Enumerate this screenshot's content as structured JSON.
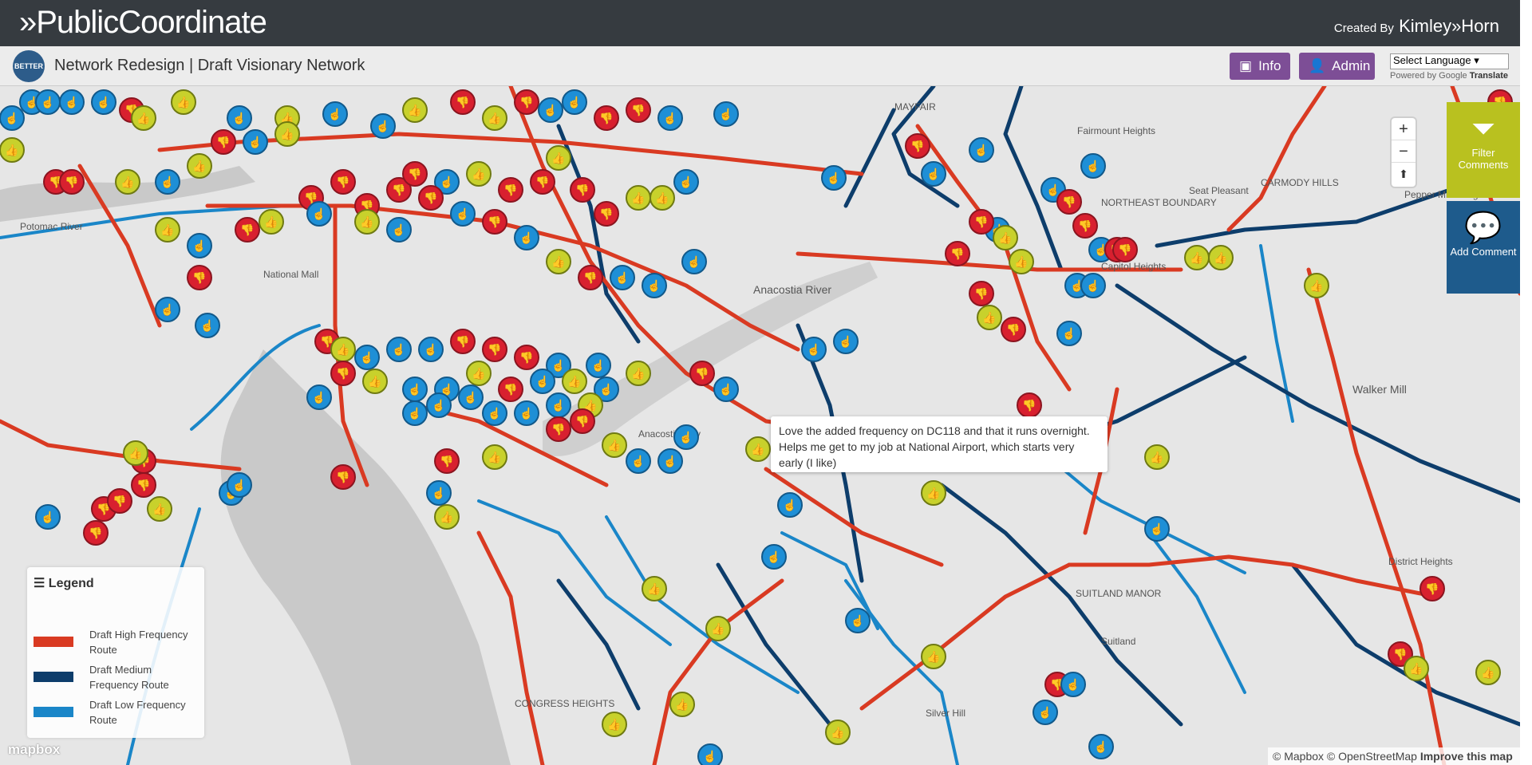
{
  "header": {
    "brand": "»PublicCoordinate",
    "credit_prefix": "Created By",
    "credit_name": "Kimley»Horn"
  },
  "subheader": {
    "logo_text": "BETTER BUS",
    "title": "Network Redesign | Draft Visionary Network",
    "info_label": "Info",
    "admin_label": "Admin",
    "language_select": "Select Language",
    "powered_by": "Powered by",
    "google": "Google",
    "translate": "Translate"
  },
  "map": {
    "zoom_in": "+",
    "zoom_out": "−",
    "reset_north": "⬆",
    "filter_label": "Filter Comments",
    "add_label": "Add Comment",
    "tooltip": "Love the added frequency on DC118 and that it runs overnight. Helps me get to my job at National Airport, which starts very early (I like)",
    "attribution": "© Mapbox © OpenStreetMap",
    "improve": "Improve this map",
    "mapbox_logo": "mapbox",
    "colors": {
      "high": "#d93a22",
      "medium": "#0d3d6b",
      "low": "#1a86c8",
      "like": "#c8d12c",
      "dislike": "#d8202f",
      "neutral": "#1e8fd6"
    },
    "places": [
      "MAYFAIR",
      "Fairmount Heights",
      "Seat Pleasant",
      "CARMODY HILLS",
      "NORTHEAST BOUNDARY",
      "Pepper Mill Village",
      "Capitol Heights",
      "Anacostia River",
      "Walker Mill",
      "District Heights",
      "SUITLAND MANOR",
      "Suitland",
      "Silver Hill",
      "CONGRESS HEIGHTS",
      "Potomac River",
      "National Mall",
      "Anacostia Fwy"
    ]
  },
  "legend": {
    "title": "Legend",
    "items": [
      {
        "label": "Draft High Frequency Route",
        "color": "#d93a22"
      },
      {
        "label": "Draft Medium Frequency Route",
        "color": "#0d3d6b"
      },
      {
        "label": "Draft Low Frequency Route",
        "color": "#1a86c8"
      }
    ]
  }
}
